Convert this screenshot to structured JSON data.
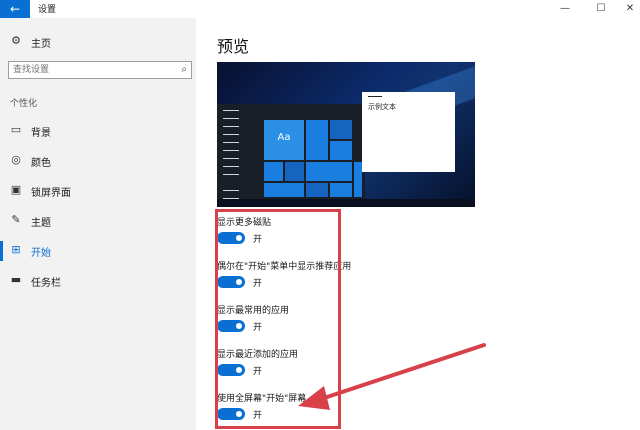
{
  "window": {
    "title": "设置",
    "back_icon": "back-arrow-icon",
    "controls": [
      "—",
      "☐",
      "✕"
    ]
  },
  "sidebar": {
    "home_label": "主页",
    "search_placeholder": "查找设置",
    "section_label": "个性化",
    "items": [
      {
        "label": "背景",
        "icon": "image-icon",
        "active": false
      },
      {
        "label": "颜色",
        "icon": "palette-icon",
        "active": false
      },
      {
        "label": "锁屏界面",
        "icon": "lock-screen-icon",
        "active": false
      },
      {
        "label": "主题",
        "icon": "theme-brush-icon",
        "active": false
      },
      {
        "label": "开始",
        "icon": "start-icon",
        "active": true
      },
      {
        "label": "任务栏",
        "icon": "taskbar-icon",
        "active": false
      }
    ]
  },
  "main": {
    "title": "预览",
    "preview": {
      "tile_text": "Aa",
      "window_text": "示例文本"
    },
    "toggles": [
      {
        "label": "显示更多磁贴",
        "state": "开",
        "on": true
      },
      {
        "label": "偶尔在\"开始\"菜单中显示推荐应用",
        "state": "开",
        "on": true
      },
      {
        "label": "显示最常用的应用",
        "state": "开",
        "on": true
      },
      {
        "label": "显示最近添加的应用",
        "state": "开",
        "on": true
      },
      {
        "label": "使用全屏幕\"开始\"屏幕",
        "state": "开",
        "on": true
      }
    ]
  },
  "colors": {
    "accent": "#0a6fd3",
    "annotation": "#d8404a"
  }
}
